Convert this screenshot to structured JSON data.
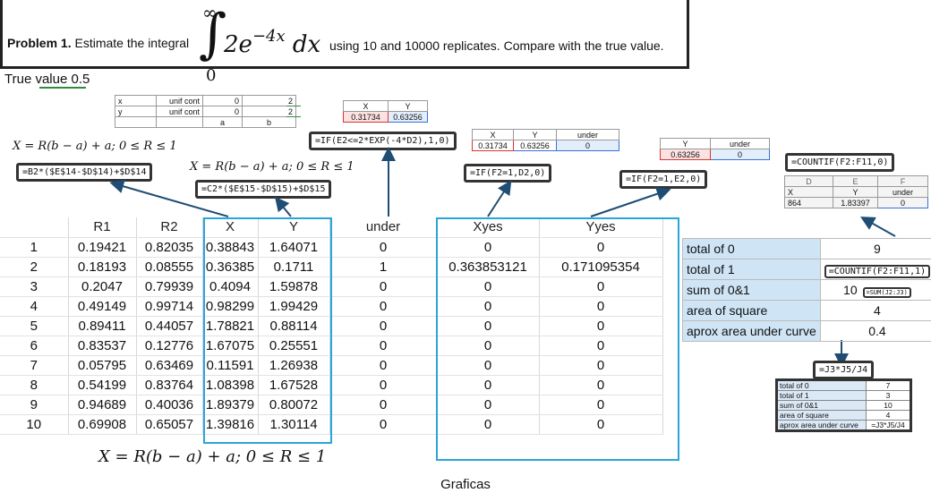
{
  "problem": {
    "label": "Problem 1.",
    "lead": "Estimate the integral",
    "upper": "∞",
    "lower": "0",
    "integrand": "2e",
    "exponent": "−4x",
    "dx": "dx",
    "rest": "using 10 and 10000 replicates. Compare with the true value."
  },
  "true_value": "True value 0.5",
  "params_table": {
    "rows": [
      [
        "x",
        "unif cont",
        "0",
        "2"
      ],
      [
        "y",
        "unif cont",
        "0",
        "2"
      ],
      [
        "",
        "",
        "a",
        "b"
      ]
    ]
  },
  "xy_snippet": {
    "headers": [
      "X",
      "Y"
    ],
    "values": [
      "0.31734",
      "0.63256"
    ]
  },
  "under_snippet": {
    "headers": [
      "X",
      "Y",
      "under"
    ],
    "values": [
      "0.31734",
      "0.63256",
      "0"
    ]
  },
  "y_under_snippet": {
    "headers": [
      "Y",
      "under"
    ],
    "values": [
      "0.63256",
      "0"
    ]
  },
  "countif_snippet": {
    "formula": "=COUNTIF(F2:F11,0)",
    "cols": [
      "D",
      "E",
      "F"
    ],
    "headers": [
      "X",
      "Y",
      "under"
    ],
    "values": [
      "864",
      "1.83397",
      "0"
    ]
  },
  "formulas": {
    "x_formula": "=B2*($E$14-$D$14)+$D$14",
    "y_formula": "=C2*($E$15-$D$15)+$D$15",
    "under_formula": "=IF(E2<=2*EXP(-4*D2),1,0)",
    "xyes_formula": "=IF(F2=1,D2,0)",
    "yyes_formula": "=IF(F2=1,E2,0)",
    "total1_formula": "=COUNTIF(F2:F11,1)",
    "sum_formula": "=SUM(J2:J3)",
    "area_formula": "=J3*J5/J4"
  },
  "math": {
    "map_x": "X = R(b − a) + a;  0 ≤ R ≤ 1",
    "map_y": "X = R(b − a) + a;  0 ≤ R ≤ 1",
    "map_footer": "X = R(b − a) + a;  0 ≤ R ≤ 1"
  },
  "sheet": {
    "headers": [
      "",
      "R1",
      "R2",
      "X",
      "Y",
      "under",
      "Xyes",
      "Yyes"
    ],
    "rows": [
      [
        "1",
        "0.19421",
        "0.82035",
        "0.38843",
        "1.64071",
        "0",
        "0",
        "0"
      ],
      [
        "2",
        "0.18193",
        "0.08555",
        "0.36385",
        "0.1711",
        "1",
        "0.363853121",
        "0.171095354"
      ],
      [
        "3",
        "0.2047",
        "0.79939",
        "0.4094",
        "1.59878",
        "0",
        "0",
        "0"
      ],
      [
        "4",
        "0.49149",
        "0.99714",
        "0.98299",
        "1.99429",
        "0",
        "0",
        "0"
      ],
      [
        "5",
        "0.89411",
        "0.44057",
        "1.78821",
        "0.88114",
        "0",
        "0",
        "0"
      ],
      [
        "6",
        "0.83537",
        "0.12776",
        "1.67075",
        "0.25551",
        "0",
        "0",
        "0"
      ],
      [
        "7",
        "0.05795",
        "0.63469",
        "0.11591",
        "1.26938",
        "0",
        "0",
        "0"
      ],
      [
        "8",
        "0.54199",
        "0.83764",
        "1.08398",
        "1.67528",
        "0",
        "0",
        "0"
      ],
      [
        "9",
        "0.94689",
        "0.40036",
        "1.89379",
        "0.80072",
        "0",
        "0",
        "0"
      ],
      [
        "10",
        "0.69908",
        "0.65057",
        "1.39816",
        "1.30114",
        "0",
        "0",
        "0"
      ]
    ]
  },
  "summary": {
    "rows": [
      {
        "label": "total of 0",
        "value": "9"
      },
      {
        "label": "total of 1",
        "value": ""
      },
      {
        "label": "sum of 0&1",
        "value": "10"
      },
      {
        "label": "area of square",
        "value": "4"
      },
      {
        "label": "aprox area under curve",
        "value": "0.4"
      }
    ]
  },
  "small_summary": {
    "rows": [
      {
        "label": "total of 0",
        "value": "7"
      },
      {
        "label": "total of 1",
        "value": "3"
      },
      {
        "label": "sum of 0&1",
        "value": "10"
      },
      {
        "label": "area of square",
        "value": "4"
      },
      {
        "label": "aprox area under curve",
        "value": "=J3*J5/J4"
      }
    ]
  },
  "caption": "Graficas",
  "colors": {
    "accent_blue": "#29a6d9",
    "label_blue": "#cfe5f6",
    "arrow": "#1f4d73"
  }
}
